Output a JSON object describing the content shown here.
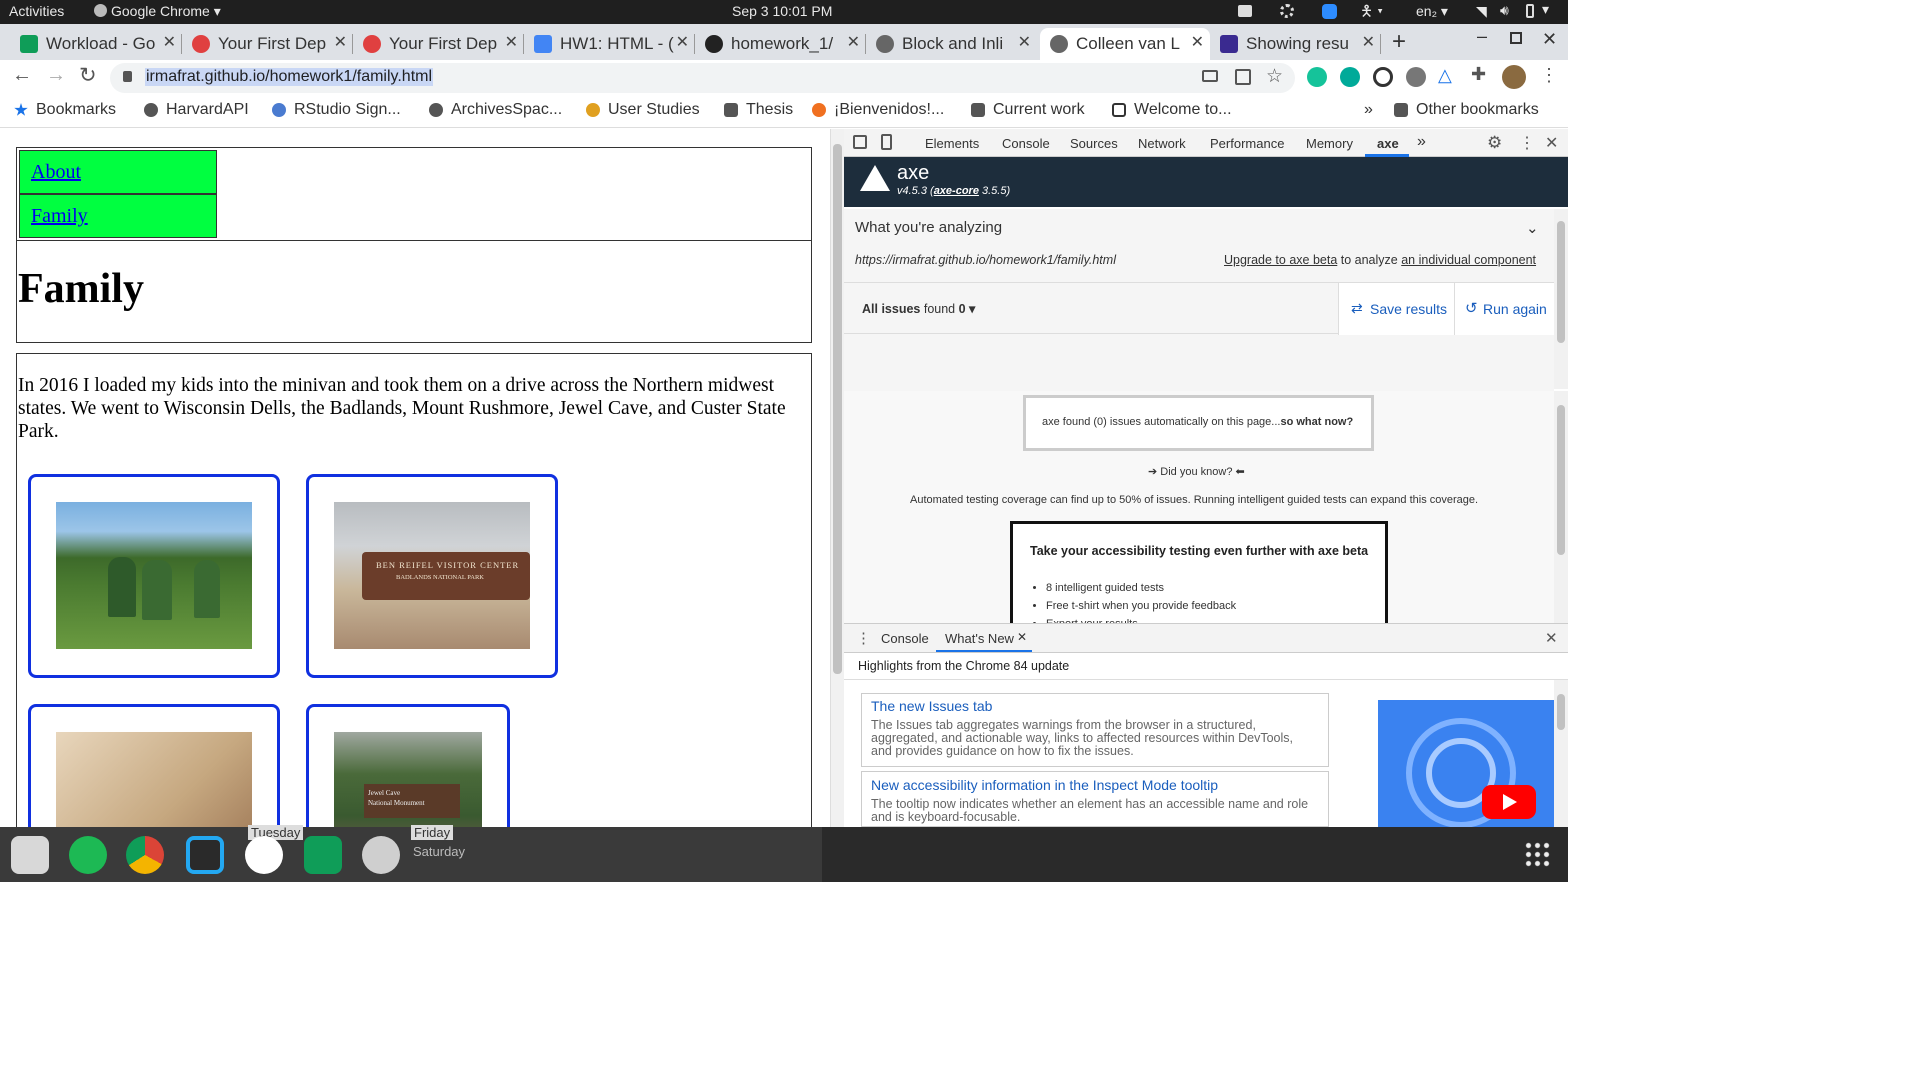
{
  "os_bar": {
    "activities": "Activities",
    "app": "Google Chrome ▾",
    "clock": "Sep 3  10:01 PM",
    "lang": "en₂ ▾"
  },
  "tabs": [
    {
      "label": "Workload - Go",
      "color": "#0f9d58"
    },
    {
      "label": "Your First Dep",
      "color": "#e04040"
    },
    {
      "label": "Your First Dep",
      "color": "#e04040"
    },
    {
      "label": "HW1: HTML - (",
      "color": "#4285f4"
    },
    {
      "label": "homework_1/",
      "color": "#222222"
    },
    {
      "label": "Block and Inli",
      "color": "#555555"
    },
    {
      "label": "Colleen van L",
      "color": "#555555"
    },
    {
      "label": "Showing resu",
      "color": "#3a2a90"
    }
  ],
  "address": {
    "url": "irmafrat.github.io/homework1/family.html"
  },
  "bookmarks": [
    {
      "label": "Bookmarks",
      "color": "#1a73e8"
    },
    {
      "label": "HarvardAPI",
      "color": "#555555"
    },
    {
      "label": "RStudio Sign...",
      "color": "#4a7bd0"
    },
    {
      "label": "ArchivesSpac...",
      "color": "#555555"
    },
    {
      "label": "User Studies",
      "color": "#e0a020"
    },
    {
      "label": "Thesis",
      "color": "#555555"
    },
    {
      "label": "¡Bienvenidos!...",
      "color": "#f07020"
    },
    {
      "label": "Current work",
      "color": "#555555"
    },
    {
      "label": "Welcome to...",
      "color": "#333333"
    },
    {
      "label": "Other bookmarks",
      "color": "#555555"
    }
  ],
  "page": {
    "nav": [
      "About",
      "Family"
    ],
    "heading": "Family",
    "paragraph": "In 2016 I loaded my kids into the minivan and took them on a drive across the Northern midwest states. We went to Wisconsin Dells, the Badlands, Mount Rushmore, Jewel Cave, and Custer State Park.",
    "sign_badlands_1": "BEN REIFEL VISITOR CENTER",
    "sign_badlands_2": "BADLANDS NATIONAL PARK",
    "sign_jewel_1": "Jewel Cave",
    "sign_jewel_2": "National Monument"
  },
  "devtools": {
    "tabs": [
      "Elements",
      "Console",
      "Sources",
      "Network",
      "Performance",
      "Memory",
      "axe",
      "»"
    ],
    "axe_title": "axe",
    "axe_version_pre": "v4.5.3 (",
    "axe_core": "axe-core",
    "axe_version_post": " 3.5.5)",
    "analyzing_label": "What you're analyzing",
    "analyzing_url": "https://irmafrat.github.io/homework1/family.html",
    "upgrade_link": "Upgrade to axe beta",
    "upgrade_mid": " to analyze ",
    "upgrade_target": "an individual component",
    "issues_label": "All issues",
    "issues_found": " found ",
    "issues_count": "0 ▾",
    "save_results": "Save results",
    "run_again": "Run again",
    "found_msg": "axe found (0) issues automatically on this page...",
    "found_bold": "so what now?",
    "did_you_know": "Did you know?",
    "coverage": "Automated testing coverage can find up to 50% of issues. Running intelligent guided tests can expand this coverage.",
    "beta_title": "Take your accessibility testing even further with axe beta",
    "beta_items": [
      "8 intelligent guided tests",
      "Free t-shirt when you provide feedback",
      "Export your results"
    ]
  },
  "drawer": {
    "tabs": [
      "Console",
      "What's New"
    ],
    "highlights": "Highlights from the Chrome 84 update",
    "cards": [
      {
        "title": "The new Issues tab",
        "body": "The Issues tab aggregates warnings from the browser in a structured, aggregated, and actionable way, links to affected resources within DevTools, and provides guidance on how to fix the issues."
      },
      {
        "title": "New accessibility information in the Inspect Mode tooltip",
        "body": "The tooltip now indicates whether an element has an accessible name and role and is keyboard-focusable."
      }
    ]
  },
  "background_text": {
    "tuesday": "Tuesday",
    "friday": "Friday",
    "saturday": "Saturday"
  }
}
